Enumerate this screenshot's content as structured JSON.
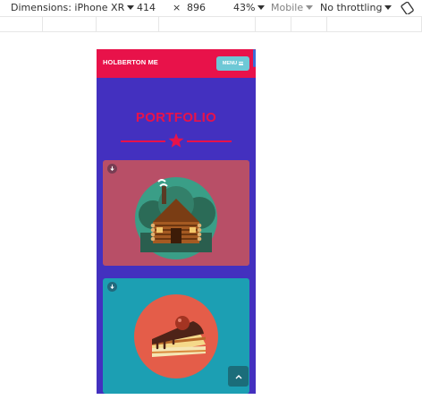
{
  "devtools": {
    "dimensions_label": "Dimensions: iPhone XR",
    "width": "414",
    "times": "×",
    "height": "896",
    "zoom": "43%",
    "mode": "Mobile",
    "throttle": "No throttling"
  },
  "site": {
    "brand": "HOLBERTON ME",
    "menu_label": "MENU",
    "section_title": "PORTFOLIO"
  },
  "portfolio_items": [
    {
      "image": "log-cabin-illustration",
      "color": "#b84f67"
    },
    {
      "image": "cake-slice-illustration",
      "color": "#1c9fb3"
    }
  ],
  "colors": {
    "primary_red": "#e8124a",
    "background_purple": "#4330bf",
    "menu_teal": "#6ec8d6"
  }
}
